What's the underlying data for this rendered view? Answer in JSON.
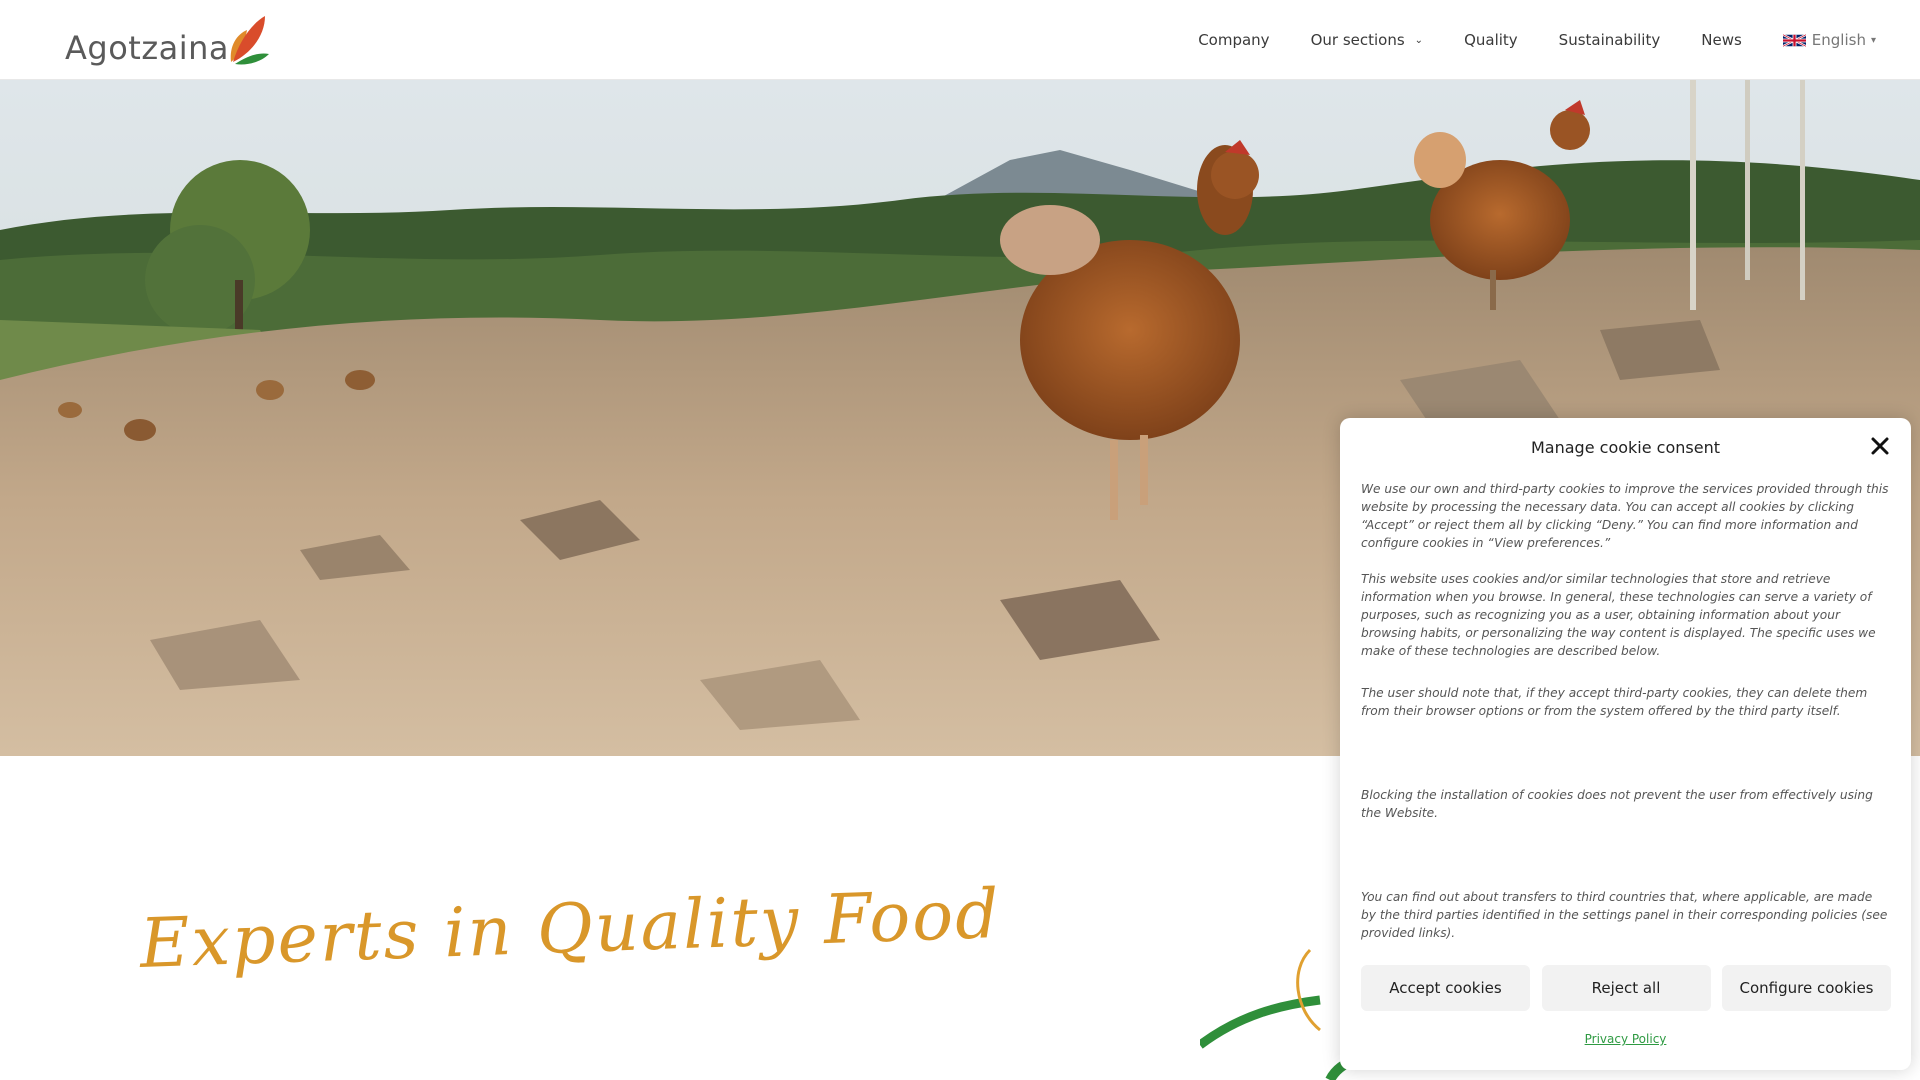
{
  "brand": {
    "name": "Agotzaina",
    "leaf_colors": [
      "#d94c2b",
      "#e08a2a",
      "#2f8f3a"
    ]
  },
  "nav": {
    "items": [
      {
        "label": "Company"
      },
      {
        "label": "Our sections"
      },
      {
        "label": "Quality"
      },
      {
        "label": "Sustainability"
      },
      {
        "label": "News"
      }
    ],
    "language": {
      "label": "English",
      "flag": "uk-flag-icon"
    }
  },
  "hero": {
    "alt_icon": "hens-on-rocky-hill-photo"
  },
  "tagline": "Experts in Quality Food",
  "cookie": {
    "title": "Manage cookie consent",
    "paragraphs": [
      "We use our own and third-party cookies to improve the services provided through this website by processing the necessary data. You can accept all cookies by clicking “Accept” or reject them all by clicking “Deny.” You can find more information and configure cookies in “View preferences.”",
      "This website uses cookies and/or similar technologies that store and retrieve information when you browse. In general, these technologies can serve a variety of purposes, such as recognizing you as a user, obtaining information about your browsing habits, or personalizing the way content is displayed. The specific uses we make of these technologies are described below.",
      "The user should note that, if they accept third-party cookies, they can delete them from their browser options or from the system offered by the third party itself.",
      "Blocking the installation of cookies does not prevent the user from effectively using the Website.",
      "You can find out about transfers to third countries that, where applicable, are made by the third parties identified in the settings panel in their corresponding policies (see provided links)."
    ],
    "buttons": {
      "accept": "Accept cookies",
      "reject": "Reject all",
      "configure": "Configure cookies"
    },
    "privacy_link": "Privacy Policy",
    "accent_color": "#2e9a42"
  }
}
